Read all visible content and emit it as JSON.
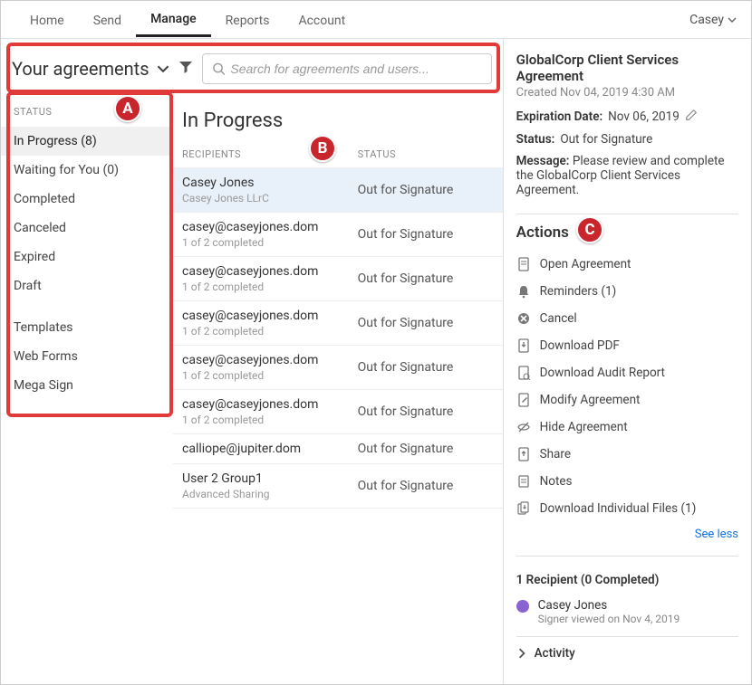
{
  "topnav": {
    "items": [
      "Home",
      "Send",
      "Manage",
      "Reports",
      "Account"
    ],
    "active_index": 2,
    "user": "Casey"
  },
  "header": {
    "title": "Your agreements",
    "search_placeholder": "Search for agreements and users..."
  },
  "sidebar": {
    "heading": "STATUS",
    "status_items": [
      {
        "label": "In Progress (8)",
        "active": true
      },
      {
        "label": "Waiting for You (0)"
      },
      {
        "label": "Completed"
      },
      {
        "label": "Canceled"
      },
      {
        "label": "Expired"
      },
      {
        "label": "Draft"
      }
    ],
    "other_items": [
      {
        "label": "Templates"
      },
      {
        "label": "Web Forms"
      },
      {
        "label": "Mega Sign"
      }
    ]
  },
  "list": {
    "title": "In Progress",
    "col_recipients": "RECIPIENTS",
    "col_status": "STATUS",
    "rows": [
      {
        "recipient": "Casey Jones",
        "sub": "Casey Jones LLrC",
        "status": "Out for Signature",
        "selected": true
      },
      {
        "recipient": "casey@caseyjones.dom",
        "sub": "1 of 2 completed",
        "status": "Out for Signature"
      },
      {
        "recipient": "casey@caseyjones.dom",
        "sub": "1 of 2 completed",
        "status": "Out for Signature"
      },
      {
        "recipient": "casey@caseyjones.dom",
        "sub": "1 of 2 completed",
        "status": "Out for Signature"
      },
      {
        "recipient": "casey@caseyjones.dom",
        "sub": "1 of 2 completed",
        "status": "Out for Signature"
      },
      {
        "recipient": "casey@caseyjones.dom",
        "sub": "1 of 2 completed",
        "status": "Out for Signature"
      },
      {
        "recipient": "calliope@jupiter.dom",
        "sub": "",
        "status": "Out for Signature"
      },
      {
        "recipient": "User 2 Group1",
        "sub": "Advanced Sharing",
        "status": "Out for Signature"
      }
    ]
  },
  "detail": {
    "title": "GlobalCorp Client Services Agreement",
    "created": "Created Nov 04, 2019 4:30 AM",
    "expiration_label": "Expiration Date:",
    "expiration_value": "Nov 06, 2019",
    "status_label": "Status:",
    "status_value": "Out for Signature",
    "message_label": "Message:",
    "message_value": "Please review and complete the GlobalCorp Client Services Agreement.",
    "actions_heading": "Actions",
    "actions": [
      {
        "icon": "doc",
        "label": "Open Agreement"
      },
      {
        "icon": "bell",
        "label": "Reminders (1)"
      },
      {
        "icon": "cancel",
        "label": "Cancel"
      },
      {
        "icon": "download",
        "label": "Download PDF"
      },
      {
        "icon": "audit",
        "label": "Download Audit Report"
      },
      {
        "icon": "modify",
        "label": "Modify Agreement"
      },
      {
        "icon": "hide",
        "label": "Hide Agreement"
      },
      {
        "icon": "share",
        "label": "Share"
      },
      {
        "icon": "notes",
        "label": "Notes"
      },
      {
        "icon": "files",
        "label": "Download Individual Files (1)"
      }
    ],
    "see_less": "See less",
    "recipient_summary": "1 Recipient (0 Completed)",
    "recipient_name": "Casey Jones",
    "recipient_sub": "Signer viewed on Nov 4, 2019",
    "activity": "Activity"
  },
  "annotations": {
    "a": "A",
    "b": "B",
    "c": "C"
  }
}
